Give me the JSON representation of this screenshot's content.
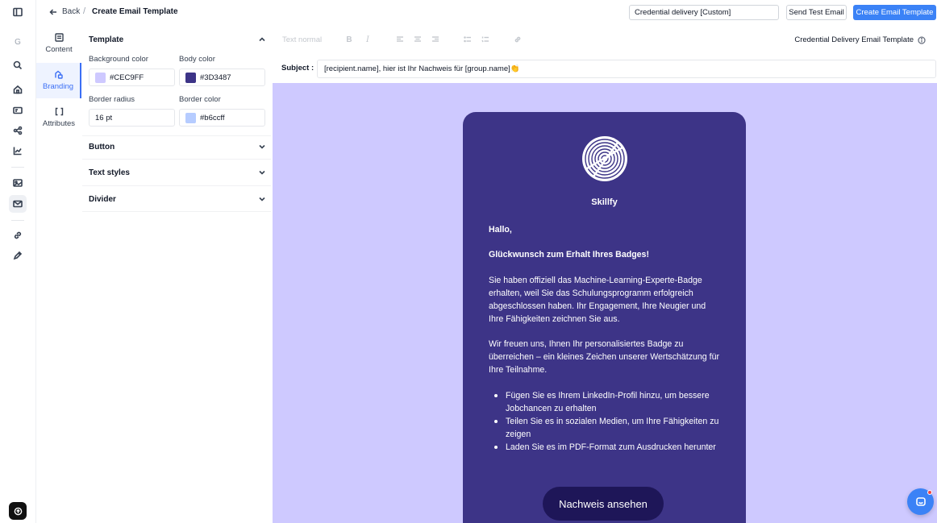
{
  "rail": {
    "items": [
      {
        "icon": "sidebar-toggle-icon"
      },
      {
        "icon": "g-letter-icon",
        "label": "G"
      },
      {
        "icon": "search-icon"
      },
      {
        "icon": "home-icon"
      },
      {
        "icon": "id-card-icon"
      },
      {
        "icon": "share-icon"
      },
      {
        "icon": "chart-line-icon"
      },
      {
        "icon": "image-icon"
      },
      {
        "icon": "mail-icon"
      },
      {
        "icon": "link-icon"
      },
      {
        "icon": "pen-tool-icon"
      },
      {
        "icon": "upload-icon"
      }
    ]
  },
  "header": {
    "back_label": "Back",
    "crumb_separator": "/",
    "title": "Create Email Template",
    "template_select_value": "Credential delivery [Custom]",
    "send_test_label": "Send Test Email",
    "create_label": "Create Email Template"
  },
  "tabs": [
    {
      "label": "Content",
      "icon": "layout-icon"
    },
    {
      "label": "Branding",
      "icon": "palette-icon",
      "active": true
    },
    {
      "label": "Attributes",
      "icon": "brackets-icon"
    }
  ],
  "panel": {
    "template": {
      "title": "Template",
      "background_color_label": "Background color",
      "background_color_value": "#CEC9FF",
      "body_color_label": "Body color",
      "body_color_value": "#3D3487",
      "border_radius_label": "Border radius",
      "border_radius_value": "16 pt",
      "border_color_label": "Border color",
      "border_color_value": "#b6ccff"
    },
    "sections": [
      "Button",
      "Text styles",
      "Divider"
    ]
  },
  "toolbar": {
    "text_style": "Text normal",
    "bold": "B",
    "italic": "I",
    "template_name": "Credential Delivery Email Template"
  },
  "subject": {
    "label": "Subject :",
    "value": "[recipient.name], hier ist Ihr Nachweis für [group.name]👏"
  },
  "email": {
    "brand": "Skillfy",
    "greeting": "Hallo,",
    "headline": "Glückwunsch zum Erhalt Ihres Badges!",
    "paragraph1": "Sie haben offiziell das Machine-Learning-Experte-Badge erhalten, weil Sie das Schulungsprogramm erfolgreich abgeschlossen haben. Ihr Engagement, Ihre Neugier und Ihre Fähigkeiten zeichnen Sie aus.",
    "paragraph2": "Wir freuen uns, Ihnen Ihr personalisiertes Badge zu überreichen – ein kleines Zeichen unserer Wertschätzung für Ihre Teilnahme.",
    "bullets": [
      "Fügen Sie es Ihrem LinkedIn-Profil hinzu, um bessere Jobchancen zu erhalten",
      "Teilen Sie es in sozialen Medien, um Ihre Fähigkeiten zu zeigen",
      "Laden Sie es im PDF-Format zum Ausdrucken herunter"
    ],
    "cta_label": "Nachweis ansehen"
  },
  "colors": {
    "canvas_bg": "#CEC9FF",
    "card_bg": "#3D3487",
    "accent": "#3b82f6",
    "cta_bg": "#1e1658"
  }
}
